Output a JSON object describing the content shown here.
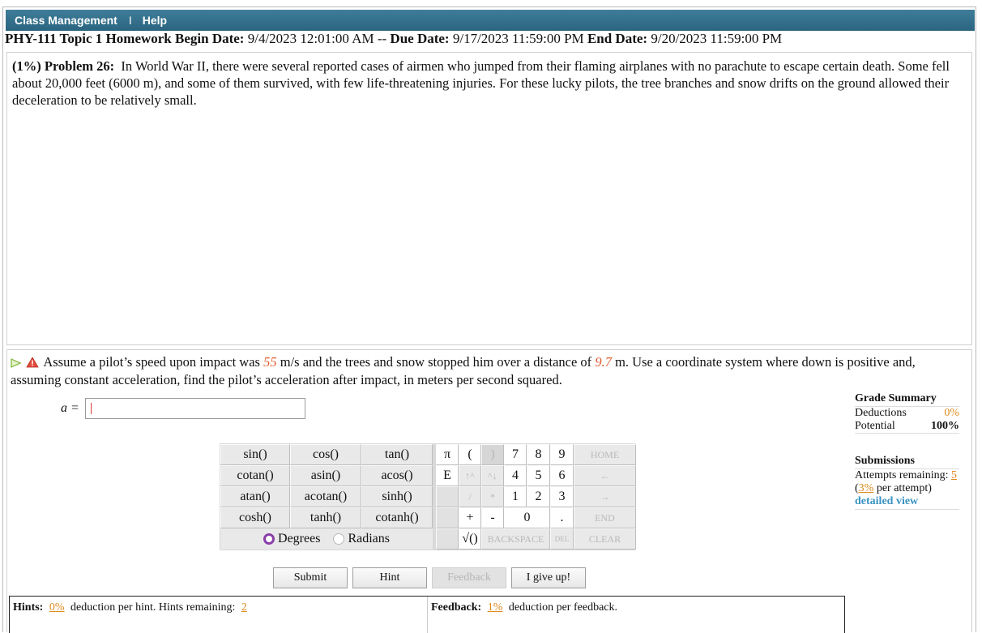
{
  "topbar": {
    "class_management": "Class Management",
    "separator": "I",
    "help": "Help"
  },
  "header": {
    "course": "PHY-111 Topic 1 Homework",
    "begin_label": "Begin Date:",
    "begin_value": "9/4/2023 12:01:00 AM",
    "sep": "--",
    "due_label": "Due Date:",
    "due_value": "9/17/2023 11:59:00 PM",
    "end_label": "End Date:",
    "end_value": "9/20/2023 11:59:00 PM"
  },
  "problem": {
    "tag": "(1%)  Problem 26:",
    "text": "In World War II, there were several reported cases of airmen who jumped from their flaming airplanes with no parachute to escape certain death. Some fell about 20,000 feet (6000 m), and some of them survived, with few life-threatening injuries. For these lucky pilots, the tree branches and snow drifts on the ground allowed their deceleration to be relatively small."
  },
  "question": {
    "part1": "Assume a pilot’s speed upon impact was",
    "speed": "55",
    "part2": "m/s and the trees and snow stopped him over a distance of",
    "distance": "9.7",
    "part3": "m. Use a coordinate system where down is positive and, assuming constant acceleration, find the pilot’s acceleration after impact, in meters per second squared."
  },
  "answer": {
    "label": "a =",
    "value": ""
  },
  "calculator": {
    "functions": [
      "sin()",
      "cos()",
      "tan()",
      "cotan()",
      "asin()",
      "acos()",
      "atan()",
      "acotan()",
      "sinh()",
      "cosh()",
      "tanh()",
      "cotanh()"
    ],
    "degrees": "Degrees",
    "radians": "Radians",
    "angle_mode": "Degrees",
    "keys": {
      "pi": "π",
      "open": "(",
      "close": ")",
      "k7": "7",
      "k8": "8",
      "k9": "9",
      "home": "HOME",
      "e": "E",
      "up": "↑^",
      "down": "^↓",
      "k4": "4",
      "k5": "5",
      "k6": "6",
      "left": "←",
      "div": "/",
      "mul": "*",
      "k1": "1",
      "k2": "2",
      "k3": "3",
      "right": "→",
      "plus": "+",
      "minus": "-",
      "k0": "0",
      "dot": ".",
      "end": "END",
      "sqrt": "√()",
      "backspace": "BACKSPACE",
      "del": "DEL",
      "clear": "CLEAR"
    }
  },
  "actions": {
    "submit": "Submit",
    "hint": "Hint",
    "feedback": "Feedback",
    "giveup": "I give up!"
  },
  "hints": {
    "label": "Hints:",
    "pct": "0%",
    "text": "deduction per hint. Hints remaining:",
    "remaining": "2"
  },
  "feedback": {
    "label": "Feedback:",
    "pct": "1%",
    "text": "deduction per feedback."
  },
  "grade": {
    "title": "Grade Summary",
    "deductions_label": "Deductions",
    "deductions_value": "0%",
    "potential_label": "Potential",
    "potential_value": "100%",
    "submissions_title": "Submissions",
    "attempts_label": "Attempts remaining:",
    "attempts_value": "5",
    "per_attempt_open": "(",
    "per_attempt_pct": "3%",
    "per_attempt_text": "per attempt)",
    "detailed_view": "detailed view"
  },
  "colors": {
    "topbar": "#2f6d8a",
    "highlight": "#e45a2c",
    "orange_link": "#e08a1e",
    "blue_link": "#3b93c4",
    "radio_selected": "#8a3fa8"
  }
}
